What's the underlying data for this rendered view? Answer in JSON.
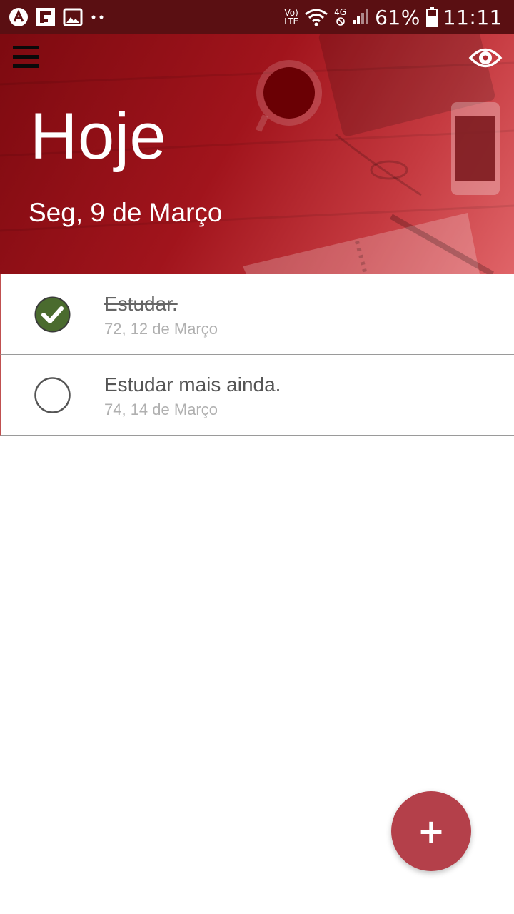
{
  "status_bar": {
    "left_icons": [
      "app-a-icon",
      "flipboard-icon",
      "gallery-icon",
      "more-dots-icon"
    ],
    "volte_top": "Vo)",
    "volte_bottom": "LTE",
    "network_label": "4G",
    "battery_percent": "61%",
    "battery_level": 0.61,
    "time": "11:11"
  },
  "header": {
    "title": "Hoje",
    "date": "Seg, 9 de Março",
    "menu_icon": "hamburger-menu-icon",
    "visibility_icon": "eye-icon",
    "gradient_colors": [
      "#7d0a10",
      "#e06468"
    ]
  },
  "tasks": [
    {
      "title": "Estudar.",
      "meta": "72, 12 de Março",
      "completed": true
    },
    {
      "title": "Estudar mais ainda.",
      "meta": "74, 14 de Março",
      "completed": false
    }
  ],
  "fab": {
    "label": "+",
    "icon": "plus-icon",
    "color": "#b4404a"
  },
  "colors": {
    "status_bar": "#5a0f12",
    "check_done": "#4a6b2e",
    "divider": "#9a9a9a"
  }
}
